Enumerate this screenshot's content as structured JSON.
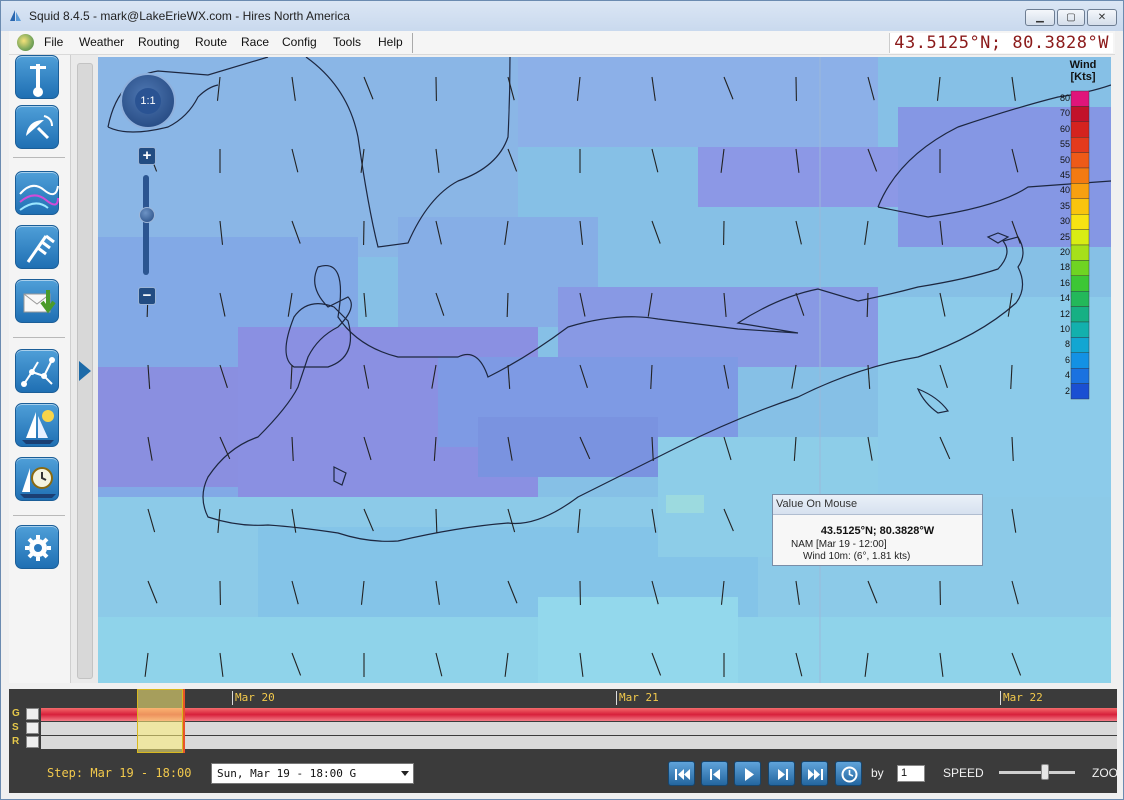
{
  "window": {
    "title": "Squid 8.4.5 - mark@LakeErieWX.com - Hires North America",
    "minimize_glyph": "▁",
    "maximize_glyph": "▢",
    "close_glyph": "✕"
  },
  "menu": {
    "items": [
      "File",
      "Weather",
      "Routing",
      "Route",
      "Race",
      "Config",
      "Tools",
      "Help"
    ]
  },
  "coordinates": "43.5125°N; 80.3828°W",
  "toolbar": {
    "icons": [
      "weather-station-icon",
      "satellite-dish-icon",
      "isobar-map-icon",
      "wind-barb-icon",
      "mail-download-icon",
      "routing-network-icon",
      "sailboat-weather-icon",
      "sailboat-clock-icon",
      "gear-icon"
    ]
  },
  "map": {
    "nav_zoom_label": "1:1",
    "zoom_in": "+",
    "zoom_out": "−",
    "zoom_level": 0.6,
    "legend": {
      "title_line1": "Wind",
      "title_line2": "[Kts]",
      "levels": [
        "80",
        "70",
        "60",
        "55",
        "50",
        "45",
        "40",
        "35",
        "30",
        "25",
        "20",
        "18",
        "16",
        "14",
        "12",
        "10",
        "8",
        "6",
        "4",
        "2"
      ],
      "colors": [
        "#e0157a",
        "#c2122a",
        "#d4231f",
        "#e43a1c",
        "#ee5a18",
        "#f37a12",
        "#f7a010",
        "#f9c40e",
        "#f7e312",
        "#d8ec14",
        "#a6e01a",
        "#6fd422",
        "#3cc735",
        "#23b85a",
        "#17b084",
        "#13b0ad",
        "#12a6d2",
        "#1391e4",
        "#1a72e0",
        "#1a4fd2"
      ]
    },
    "tooltip": {
      "title": "Value On Mouse",
      "coord": "43.5125°N; 80.3828°W",
      "model": "NAM  [Mar 19 - 12:00]",
      "wind": "Wind 10m: (6°, 1.81 kts)"
    }
  },
  "timeline": {
    "dates": [
      "Mar 20",
      "Mar 21",
      "Mar 22"
    ],
    "rows": [
      "G",
      "S",
      "R"
    ]
  },
  "bottom": {
    "step": "Step: Mar 19 - 18:00",
    "time_select": "Sun, Mar 19 - 18:00 G",
    "by_label": "by",
    "by_value": "1",
    "speed_label": "SPEED",
    "speed_value": 0.55,
    "zoom_label": "ZOO"
  },
  "playback": [
    "first-icon",
    "step-back-icon",
    "play-icon",
    "step-forward-icon",
    "last-icon",
    "clock-icon"
  ]
}
